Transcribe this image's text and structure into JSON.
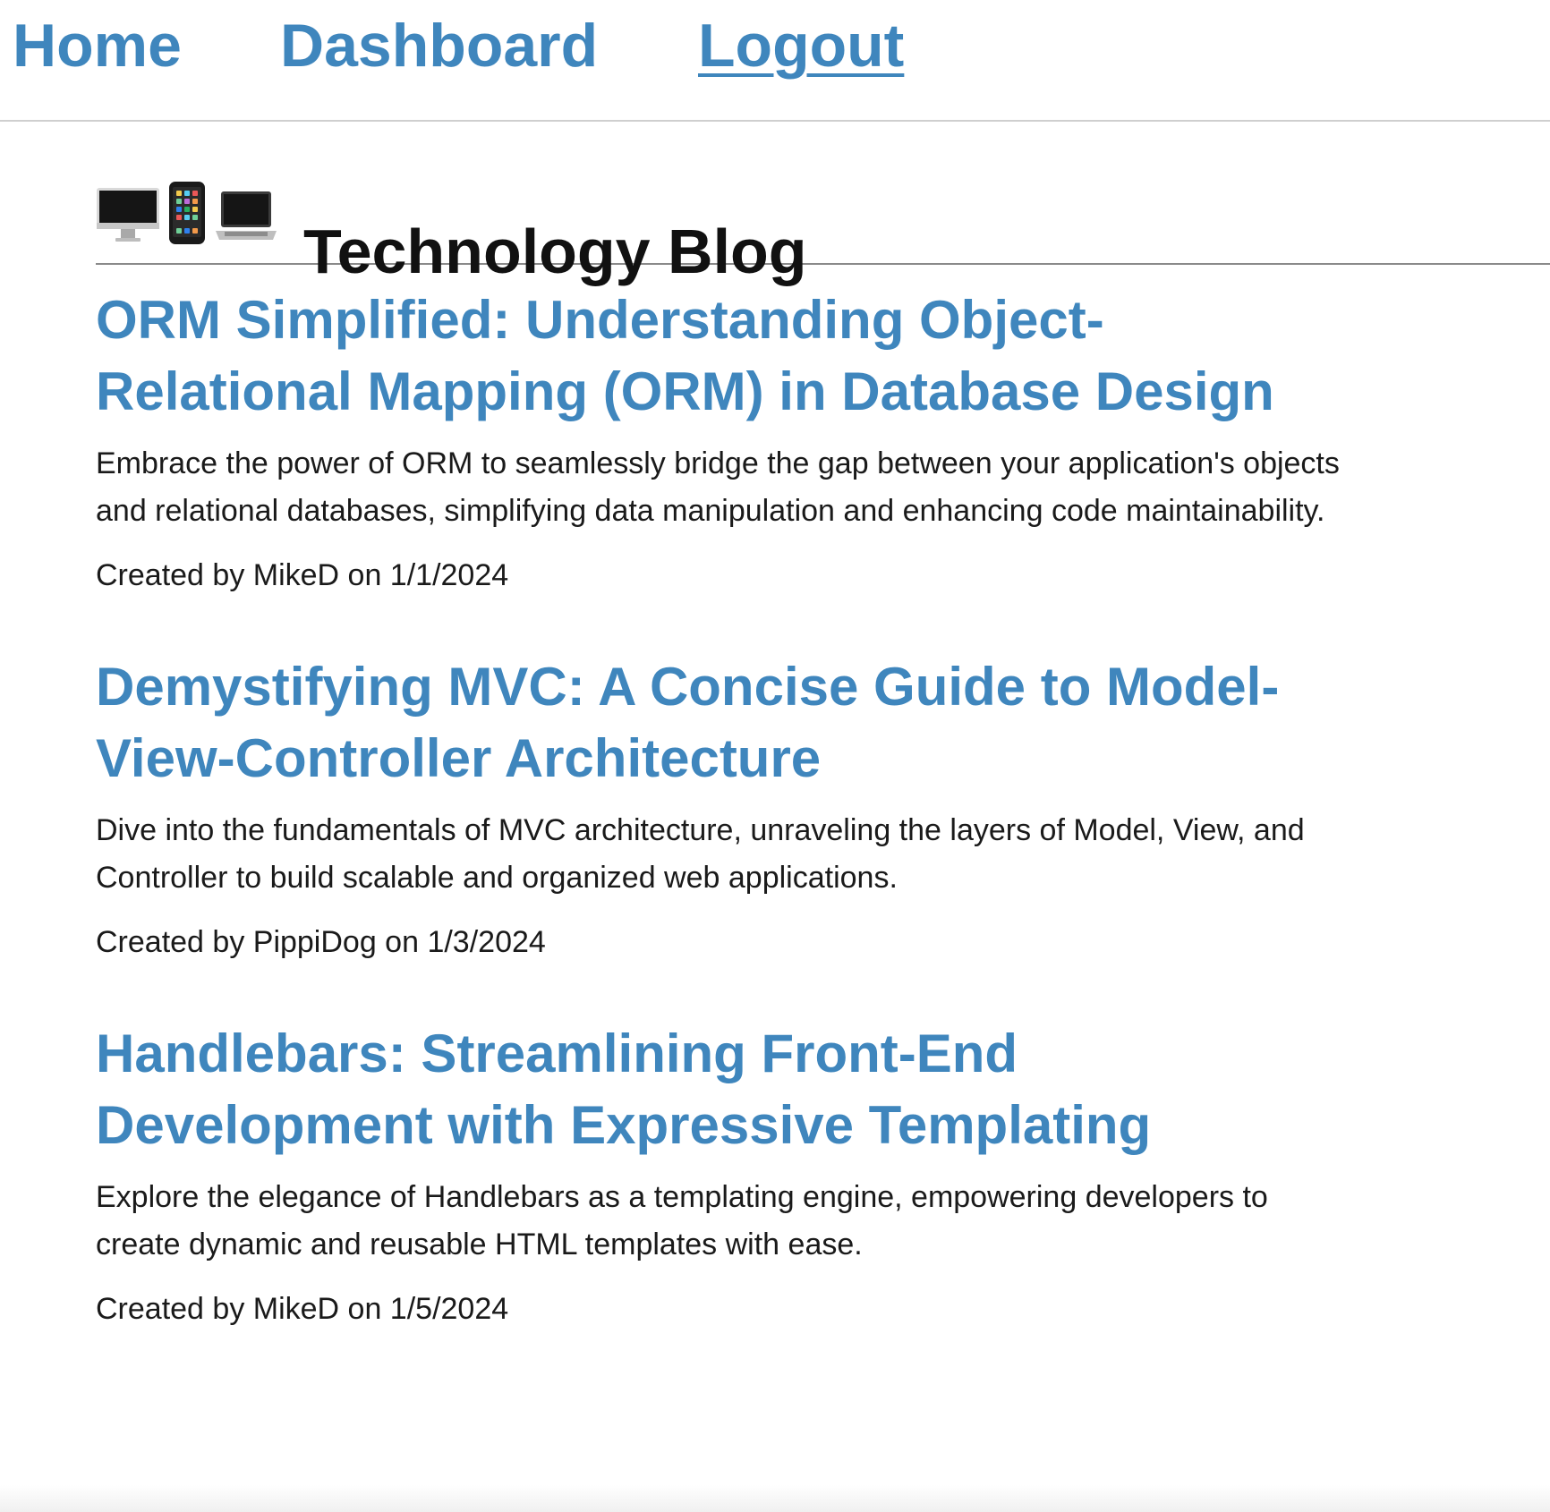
{
  "nav": {
    "home": "Home",
    "dashboard": "Dashboard",
    "logout": "Logout"
  },
  "blog": {
    "title": "Technology Blog",
    "icons": [
      "desktop-computer-icon",
      "mobile-phone-icon",
      "laptop-icon"
    ]
  },
  "colors": {
    "link": "#3f86bd",
    "text": "#1a1a1a"
  },
  "posts": [
    {
      "title": "ORM Simplified: Understanding Object-Relational Mapping (ORM) in Database Design",
      "summary": "Embrace the power of ORM to seamlessly bridge the gap between your application's objects and relational databases, simplifying data manipulation and enhancing code maintainability.",
      "meta": "Created by MikeD on 1/1/2024"
    },
    {
      "title": "Demystifying MVC: A Concise Guide to Model-View-Controller Architecture",
      "summary": "Dive into the fundamentals of MVC architecture, unraveling the layers of Model, View, and Controller to build scalable and organized web applications.",
      "meta": "Created by PippiDog on 1/3/2024"
    },
    {
      "title": "Handlebars: Streamlining Front-End Development with Expressive Templating",
      "summary": "Explore the elegance of Handlebars as a templating engine, empowering developers to create dynamic and reusable HTML templates with ease.",
      "meta": "Created by MikeD on 1/5/2024"
    }
  ]
}
